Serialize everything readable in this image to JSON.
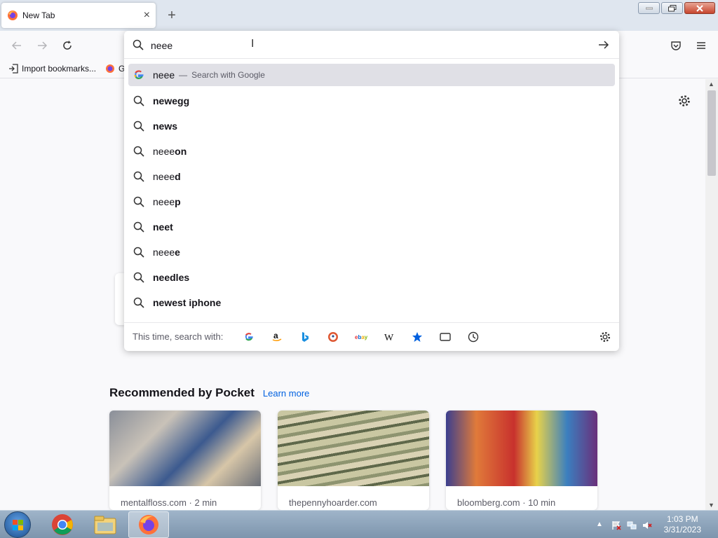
{
  "browser": {
    "tab_title": "New Tab",
    "new_tab_label": "+",
    "tab_close": "×"
  },
  "urlbar": {
    "value": "neee",
    "suggestions": [
      {
        "typed": "neee",
        "completion": "",
        "action": "Search with Google",
        "engine": "google",
        "active": true
      },
      {
        "typed": "",
        "completion": "newegg"
      },
      {
        "typed": "",
        "completion": "news"
      },
      {
        "typed": "neee",
        "completion": "on"
      },
      {
        "typed": "neee",
        "completion": "d"
      },
      {
        "typed": "neee",
        "completion": "p"
      },
      {
        "typed": "",
        "completion": "neet"
      },
      {
        "typed": "neee",
        "completion": "e"
      },
      {
        "typed": "",
        "completion": "needles"
      },
      {
        "typed": "",
        "completion": "newest iphone"
      }
    ],
    "separator": "—",
    "oneoff_label": "This time, search with:",
    "oneoff_engines": [
      "google",
      "amazon",
      "bing",
      "duckduckgo",
      "ebay",
      "wikipedia",
      "bookmarks",
      "tabs",
      "history"
    ]
  },
  "bookmarks": {
    "import": "Import bookmarks...",
    "second_initial": "G"
  },
  "pocket": {
    "heading": "Recommended by Pocket",
    "learn_more": "Learn more",
    "cards": [
      {
        "source": "mentalfloss.com · 2 min"
      },
      {
        "source": "thepennyhoarder.com"
      },
      {
        "source": "bloomberg.com · 10 min"
      }
    ]
  },
  "taskbar": {
    "time": "1:03 PM",
    "date": "3/31/2023"
  }
}
